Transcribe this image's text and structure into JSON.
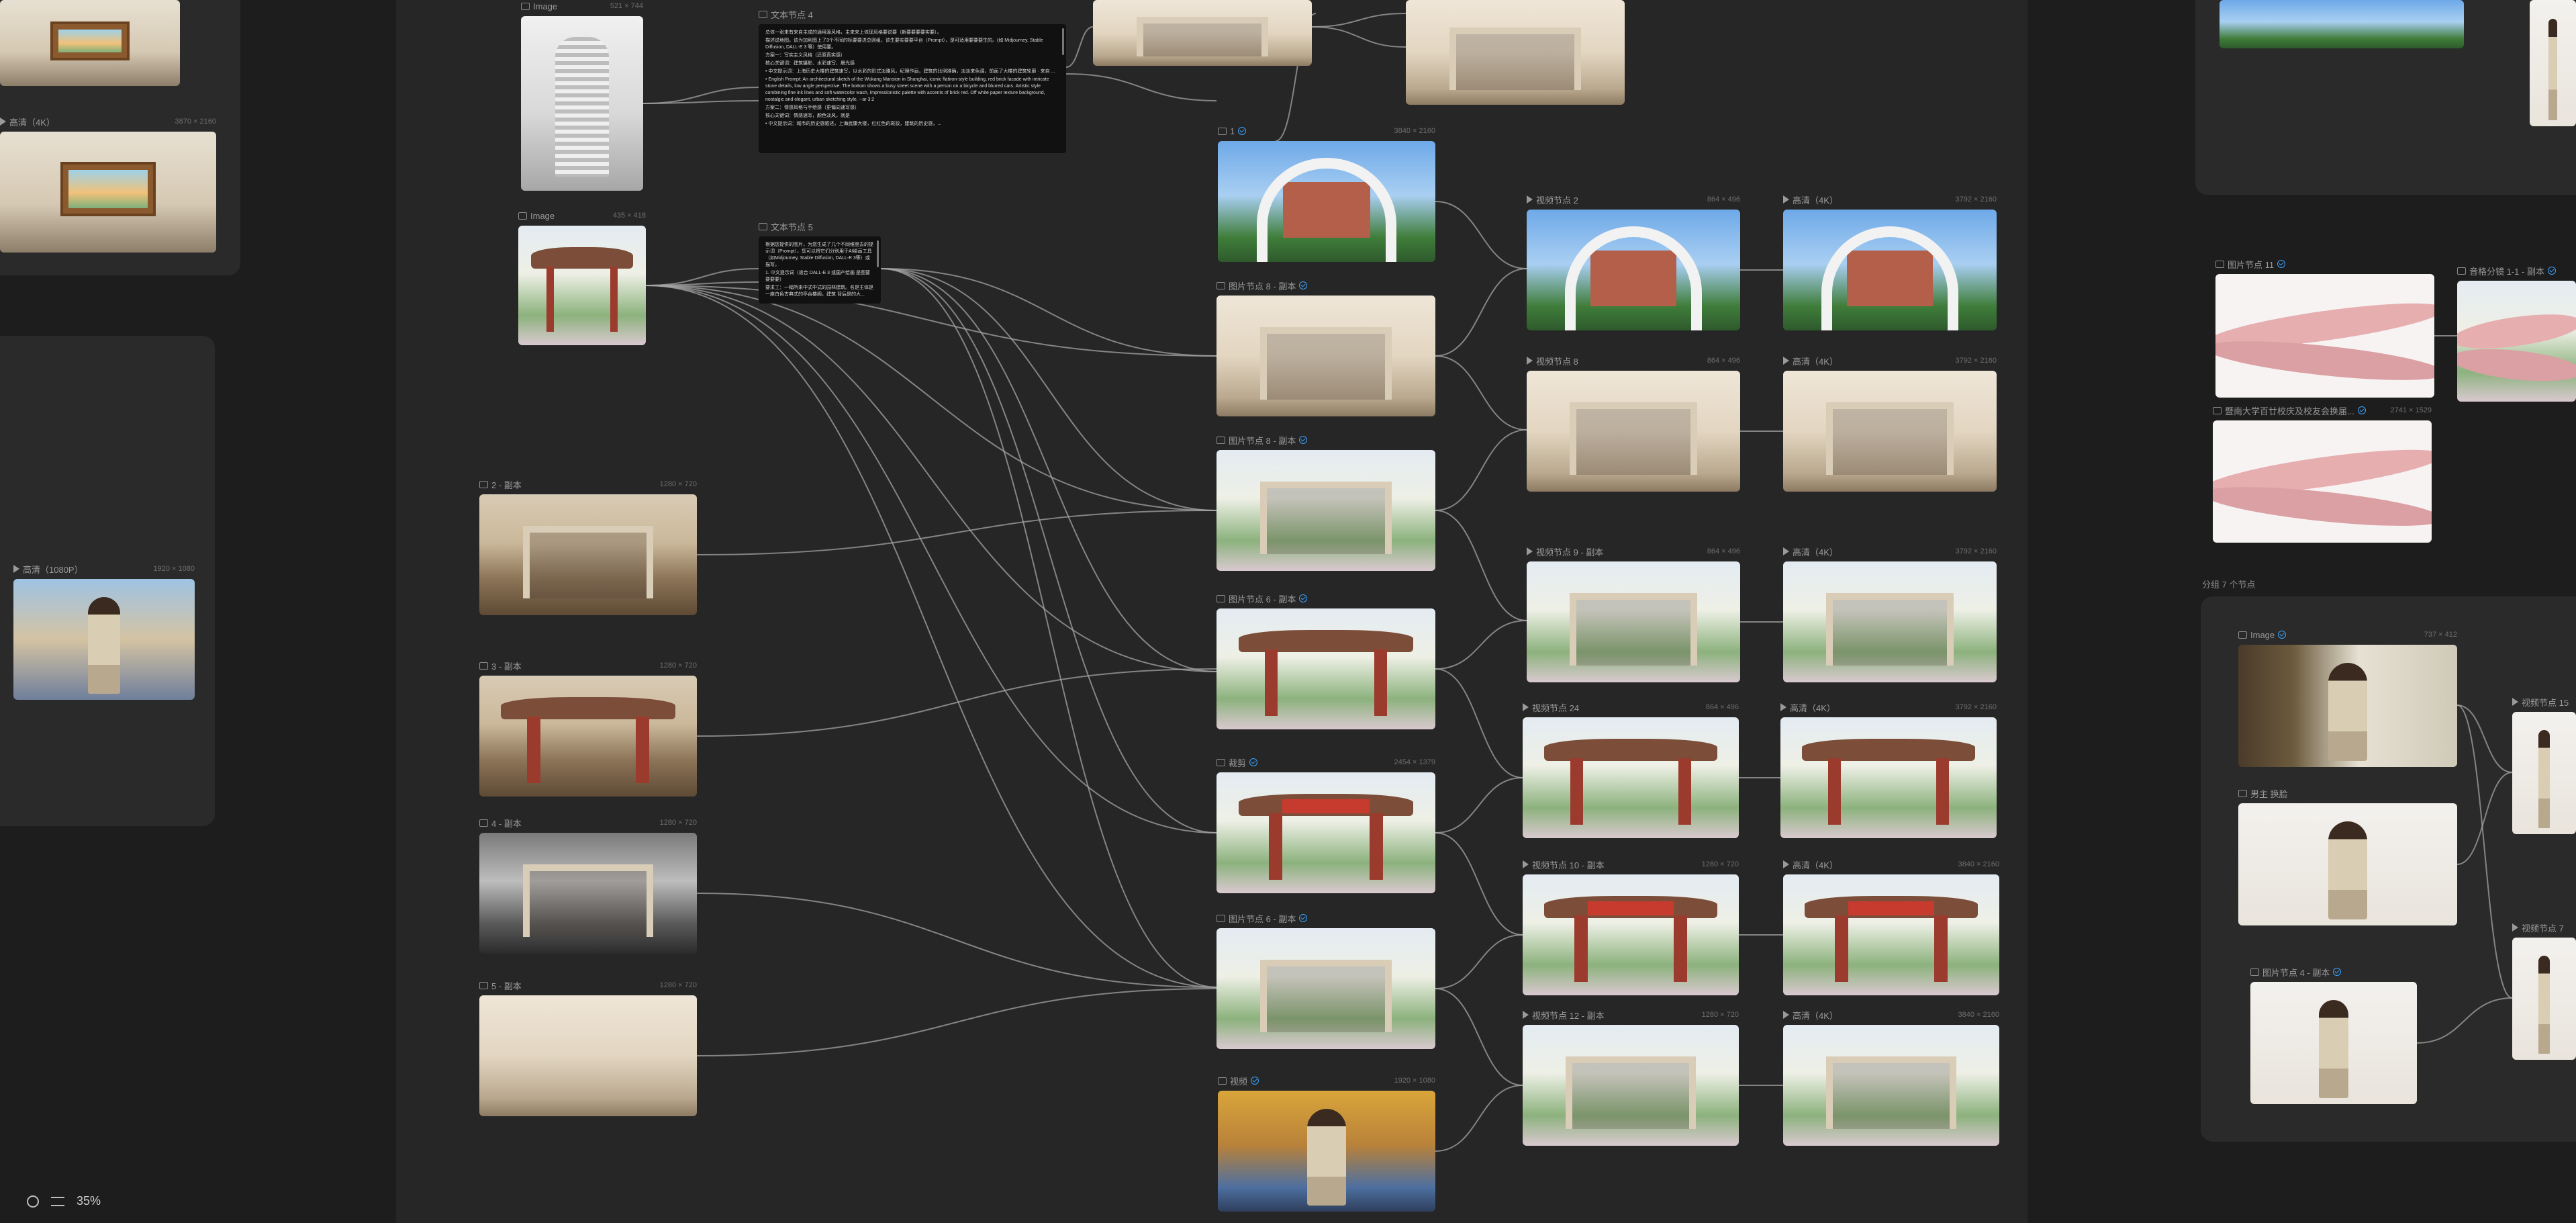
{
  "zoom": "35%",
  "groups": {
    "group_7": "分组 7 个节点"
  },
  "nodes": [
    {
      "id": "n-left-top",
      "title": "",
      "dims": "",
      "icon": "image",
      "check": false,
      "pal": "p-room",
      "art": "frame"
    },
    {
      "id": "n-hd4k-left",
      "title": "高清（4K）",
      "dims": "3870 × 2160",
      "icon": "video",
      "check": false,
      "pal": "p-room",
      "art": "frame"
    },
    {
      "id": "n-hd1080",
      "title": "高清（1080P）",
      "dims": "1920 × 1080",
      "icon": "video",
      "check": false,
      "pal": "p-street",
      "art": "person"
    },
    {
      "id": "n-image1",
      "title": "Image",
      "dims": "521 × 744",
      "icon": "image",
      "check": false,
      "pal": "p-sketch",
      "art": "tower"
    },
    {
      "id": "n-image2",
      "title": "Image",
      "dims": "435 × 418",
      "icon": "image",
      "check": false,
      "pal": "p-water",
      "art": "roof"
    },
    {
      "id": "n-copy2",
      "title": "2 - 副本",
      "dims": "1280 × 720",
      "icon": "image",
      "check": false,
      "pal": "p-sepia",
      "art": "gate"
    },
    {
      "id": "n-copy3",
      "title": "3 - 副本",
      "dims": "1280 × 720",
      "icon": "image",
      "check": false,
      "pal": "p-sepia",
      "art": "roof"
    },
    {
      "id": "n-copy4",
      "title": "4 - 副本",
      "dims": "1280 × 720",
      "icon": "image",
      "check": false,
      "pal": "p-bw",
      "art": "gate"
    },
    {
      "id": "n-copy5",
      "title": "5 - 副本",
      "dims": "1280 × 720",
      "icon": "image",
      "check": false,
      "pal": "p-beige",
      "art": "bldg"
    },
    {
      "id": "n-top-a",
      "title": "",
      "dims": "",
      "icon": "image",
      "check": false,
      "pal": "p-beige",
      "art": "gate"
    },
    {
      "id": "n-top-b",
      "title": "",
      "dims": "",
      "icon": "image",
      "check": false,
      "pal": "p-beige",
      "art": "gate"
    },
    {
      "id": "n-img-1",
      "title": "1",
      "dims": "3840 × 2160",
      "icon": "image",
      "check": true,
      "pal": "p-sky",
      "art": "arch"
    },
    {
      "id": "n-img-node8a",
      "title": "图片节点 8 - 副本",
      "dims": "",
      "icon": "image",
      "check": true,
      "pal": "p-beige",
      "art": "gate"
    },
    {
      "id": "n-img-node8b",
      "title": "图片节点 8 - 副本",
      "dims": "",
      "icon": "image",
      "check": true,
      "pal": "p-water",
      "art": "gate"
    },
    {
      "id": "n-img-node6",
      "title": "图片节点 6 - 副本",
      "dims": "",
      "icon": "image",
      "check": true,
      "pal": "p-water",
      "art": "roof"
    },
    {
      "id": "n-crop",
      "title": "裁剪",
      "dims": "2454 × 1379",
      "icon": "image",
      "check": true,
      "pal": "p-water",
      "art": "redban"
    },
    {
      "id": "n-img-node6b",
      "title": "图片节点 6 - 副本",
      "dims": "",
      "icon": "image",
      "check": true,
      "pal": "p-water",
      "art": "gate"
    },
    {
      "id": "n-video",
      "title": "视频",
      "dims": "1920 × 1080",
      "icon": "image",
      "check": true,
      "pal": "p-yellow",
      "art": "person"
    },
    {
      "id": "n-vid2",
      "title": "视频节点 2",
      "dims": "864 × 496",
      "icon": "video",
      "check": false,
      "pal": "p-sky",
      "art": "arch"
    },
    {
      "id": "n-vid8",
      "title": "视频节点 8",
      "dims": "864 × 496",
      "icon": "video",
      "check": false,
      "pal": "p-beige",
      "art": "gate"
    },
    {
      "id": "n-vid9",
      "title": "视频节点 9 - 副本",
      "dims": "864 × 496",
      "icon": "video",
      "check": false,
      "pal": "p-water",
      "art": "gate"
    },
    {
      "id": "n-vid24",
      "title": "视频节点 24",
      "dims": "864 × 496",
      "icon": "video",
      "check": false,
      "pal": "p-water",
      "art": "roof"
    },
    {
      "id": "n-vid10",
      "title": "视频节点 10 - 副本",
      "dims": "1280 × 720",
      "icon": "video",
      "check": false,
      "pal": "p-water",
      "art": "redban"
    },
    {
      "id": "n-vid12",
      "title": "视频节点 12 - 副本",
      "dims": "1280 × 720",
      "icon": "video",
      "check": false,
      "pal": "p-water",
      "art": "gate"
    },
    {
      "id": "n-hd-1",
      "title": "高清（4K）",
      "dims": "3792 × 2160",
      "icon": "video",
      "check": false,
      "pal": "p-sky",
      "art": "arch"
    },
    {
      "id": "n-hd-2",
      "title": "高清（4K）",
      "dims": "3792 × 2160",
      "icon": "video",
      "check": false,
      "pal": "p-beige",
      "art": "gate"
    },
    {
      "id": "n-hd-3",
      "title": "高清（4K）",
      "dims": "3792 × 2160",
      "icon": "video",
      "check": false,
      "pal": "p-water",
      "art": "gate"
    },
    {
      "id": "n-hd-4",
      "title": "高清（4K）",
      "dims": "3792 × 2160",
      "icon": "video",
      "check": false,
      "pal": "p-water",
      "art": "roof"
    },
    {
      "id": "n-hd-5",
      "title": "高清（4K）",
      "dims": "3840 × 2160",
      "icon": "video",
      "check": false,
      "pal": "p-water",
      "art": "redban"
    },
    {
      "id": "n-hd-6",
      "title": "高清（4K）",
      "dims": "3840 × 2160",
      "icon": "video",
      "check": false,
      "pal": "p-water",
      "art": "gate"
    },
    {
      "id": "n-r-top",
      "title": "",
      "dims": "",
      "icon": "image",
      "check": false,
      "pal": "p-sky",
      "art": ""
    },
    {
      "id": "n-r-person",
      "title": "",
      "dims": "",
      "icon": "image",
      "check": false,
      "pal": "p-studio",
      "art": "person"
    },
    {
      "id": "n-img11",
      "title": "图片节点 11",
      "dims": "",
      "icon": "image",
      "check": true,
      "pal": "p-ribbon",
      "art": "ribbon"
    },
    {
      "id": "n-yinge",
      "title": "音格分镜 1-1 - 副本",
      "dims": "",
      "icon": "image",
      "check": true,
      "pal": "p-water",
      "art": "ribbon"
    },
    {
      "id": "n-jinan",
      "title": "暨南大学百廿校庆及校友会换届...",
      "dims": "2741 × 1529",
      "icon": "image",
      "check": true,
      "pal": "p-ribbon",
      "art": "ribbon"
    },
    {
      "id": "n-image3",
      "title": "Image",
      "dims": "737 × 412",
      "icon": "image",
      "check": true,
      "pal": "p-tree",
      "art": "person"
    },
    {
      "id": "n-main",
      "title": "男主 换脸",
      "dims": "",
      "icon": "image",
      "check": false,
      "pal": "p-studio",
      "art": "person"
    },
    {
      "id": "n-img4",
      "title": "图片节点 4 - 副本",
      "dims": "",
      "icon": "image",
      "check": true,
      "pal": "p-studio",
      "art": "person"
    },
    {
      "id": "n-vid15",
      "title": "视频节点 15",
      "dims": "",
      "icon": "video",
      "check": false,
      "pal": "p-studio",
      "art": "person"
    },
    {
      "id": "n-vid7",
      "title": "视频节点 7",
      "dims": "",
      "icon": "video",
      "check": false,
      "pal": "p-studio",
      "art": "person"
    }
  ],
  "text_nodes": [
    {
      "id": "t4",
      "title": "文本节点 4",
      "lines": [
        "总体一张来有来自主成的通用源风格，主来来上体现风格要说要（新要要要要实要）。",
        "描述说地图。该为加利图上了3个不同的标要要进总则组，该生要实要要平台（Prompt），是可适用要要要生的。(如 Midjourney, Stable Diffusion, DALL-E 3 等）使用要。",
        "方案一：写实主义风格（还原真实感）",
        "核心关键词：建筑摄影、水彩速写、晨光感",
        "• 中文提示词：上海历史大楼的建筑速写，以水彩的形式淡雅风，纪理作画，建筑的比例准确，淡淡来色调，前面了大楼的建筑轮廓 · 来自 ...",
        "• English Prompt: An architectural sketch of the Wukang Mansion in Shanghai, iconic flatiron-style building, red brick facade with intricate stone details, low angle perspective. The bottom shows a busy street scene with a person on a bicycle and blurred cars. Artistic style combining fine ink lines and soft watercolor wash, impressionistic palette with accents of brick red. Off white paper texture background, nostalgic and elegant, urban sketching style. --ar 3:2",
        "方案二：情感风格与手绘感（更偏向速写感）",
        "核心关键词：情感速写，颜色淡风，就是",
        "• 中文提示词：城市的历史感叙述，上海武康大楼，红红色的斑驳，建筑的历史感，..."
      ]
    },
    {
      "id": "t5",
      "title": "文本节点 5",
      "lines": [
        "根据您提供的图片，为您生成了几个不同维度去的提示词（Prompt），您可以将它们分别用于AI绘画工具（如Midjourney, Stable Diffusion, DALL-E 3等）或描写。",
        "1. 中文提示词（适合 DALL-E 3 或国产绘画 是图要要要要）",
        "要求工：一幅所来中式中式的园林建筑。名是主体是一座白色古典式的亭台楼阁，建筑 背后是的大..."
      ]
    }
  ]
}
